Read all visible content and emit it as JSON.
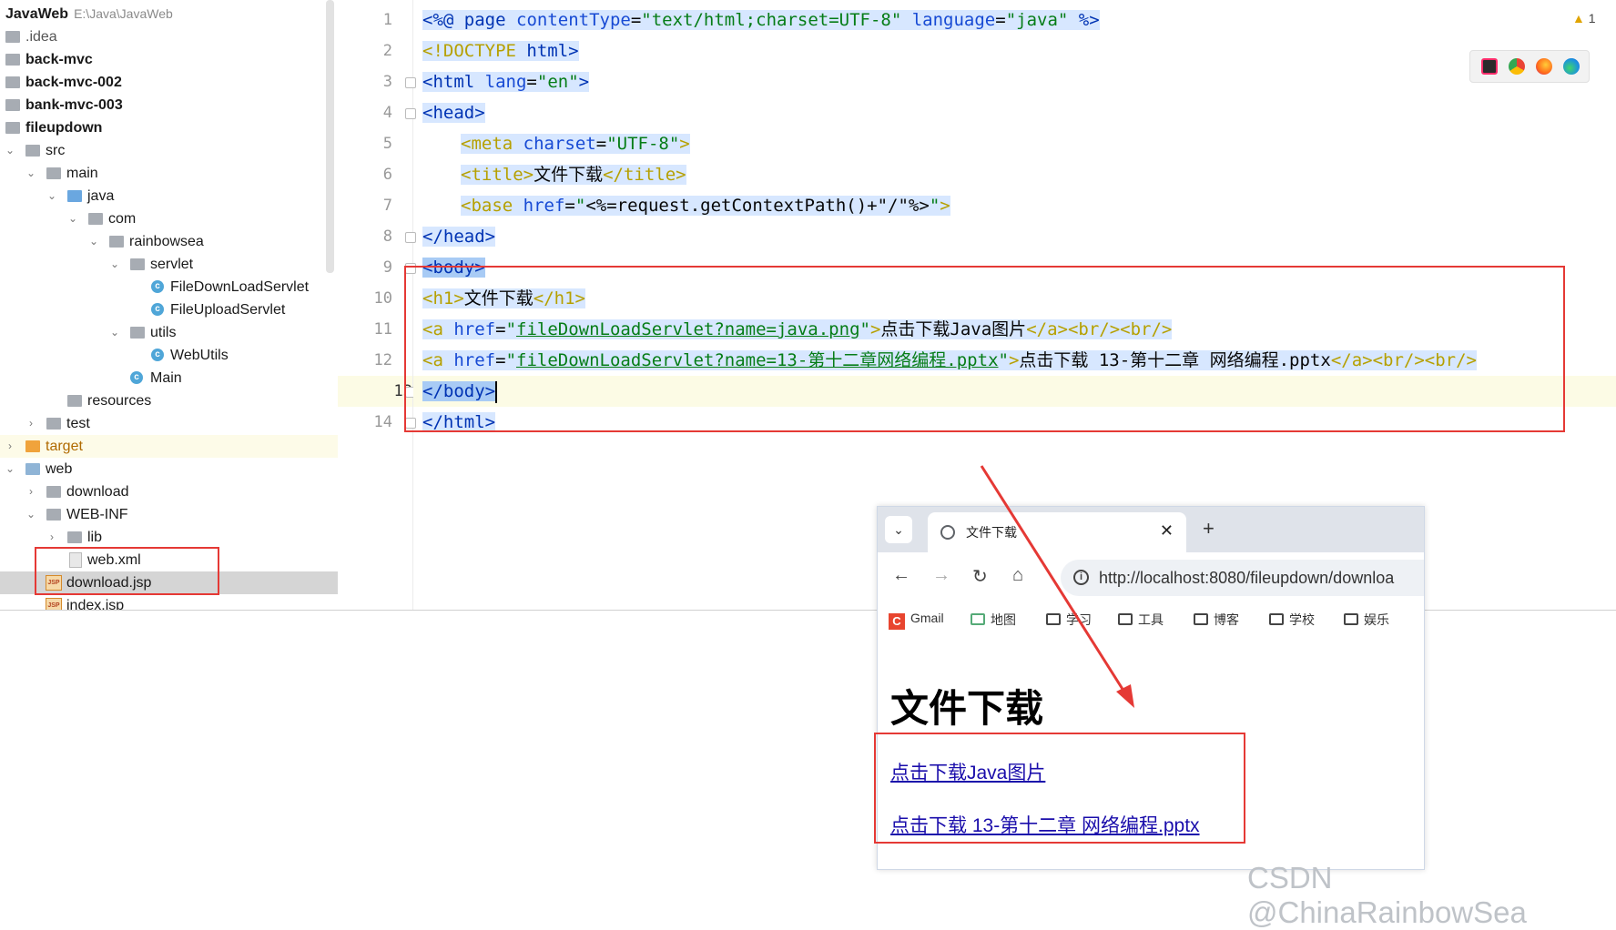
{
  "project_tree": {
    "root_name": "JavaWeb",
    "root_path": "E:\\Java\\JavaWeb",
    "items": [
      {
        "label": ".idea"
      },
      {
        "label": "back-mvc"
      },
      {
        "label": "back-mvc-002"
      },
      {
        "label": "bank-mvc-003"
      },
      {
        "label": "fileupdown"
      },
      {
        "label": "src"
      },
      {
        "label": "main"
      },
      {
        "label": "java"
      },
      {
        "label": "com"
      },
      {
        "label": "rainbowsea"
      },
      {
        "label": "servlet"
      },
      {
        "label": "FileDownLoadServlet"
      },
      {
        "label": "FileUploadServlet"
      },
      {
        "label": "utils"
      },
      {
        "label": "WebUtils"
      },
      {
        "label": "Main"
      },
      {
        "label": "resources"
      },
      {
        "label": "test"
      },
      {
        "label": "target"
      },
      {
        "label": "web"
      },
      {
        "label": "download"
      },
      {
        "label": "WEB-INF"
      },
      {
        "label": "lib"
      },
      {
        "label": "web.xml"
      },
      {
        "label": "download.jsp"
      },
      {
        "label": "index.jsp"
      }
    ]
  },
  "editor": {
    "line_numbers": [
      "1",
      "2",
      "3",
      "4",
      "5",
      "6",
      "7",
      "8",
      "9",
      "10",
      "11",
      "12",
      "13",
      "14"
    ],
    "l1": {
      "open": "<%@",
      "kw": "page",
      "a1": "contentType",
      "eq1": "=",
      "v1": "\"text/html;charset=UTF-8\"",
      "a2": "language",
      "eq2": "=",
      "v2": "\"java\"",
      "close": "%>"
    },
    "l2": {
      "doctype": "<!DOCTYPE",
      "html": "html",
      "gt": ">"
    },
    "l3": {
      "open": "<html",
      "attr": "lang",
      "eq": "=",
      "val": "\"en\"",
      "gt": ">"
    },
    "l4": {
      "text": "<head>"
    },
    "l5": {
      "open": "<meta",
      "attr": "charset",
      "eq": "=",
      "val": "\"UTF-8\"",
      "gt": ">"
    },
    "l6": {
      "open": "<title>",
      "text": "文件下载",
      "close": "</title>"
    },
    "l7": {
      "open": "<base",
      "attr": "href",
      "eq": "=",
      "q1": "\"",
      "expr": "<%=request.getContextPath()+\"/\"%>",
      "q2": "\"",
      "gt": ">"
    },
    "l8": {
      "text": "</head>"
    },
    "l9": {
      "text": "<body>"
    },
    "l10": {
      "open": "<h1>",
      "text": "文件下载",
      "close": "</h1>"
    },
    "l11": {
      "open": "<a",
      "attr": "href",
      "eq": "=",
      "q1": "\"",
      "url": "fileDownLoadServlet?name=java.png",
      "q2": "\"",
      "gt": ">",
      "text": "点击下载Java图片",
      "close": "</a><br/><br/>"
    },
    "l12": {
      "open": "<a",
      "attr": "href",
      "eq": "=",
      "q1": "\"",
      "url": "fileDownLoadServlet?name=13-第十二章网络编程.pptx",
      "q2": "\"",
      "gt": ">",
      "text": "点击下载 13-第十二章 网络编程.pptx",
      "close": "</a><br/><br/>"
    },
    "l13": {
      "text": "</body>"
    },
    "l14": {
      "text": "</html>"
    }
  },
  "inspection": {
    "warning_count": "1"
  },
  "browser": {
    "tab_title": "文件下载",
    "url": "http://localhost:8080/fileupdown/downloa",
    "bookmarks": [
      "Gmail",
      "地图",
      "学习",
      "工具",
      "博客",
      "学校",
      "娱乐"
    ],
    "page_heading": "文件下载",
    "link1": "点击下载Java图片",
    "link2": "点击下载 13-第十二章 网络编程.pptx"
  },
  "watermark": "CSDN @ChinaRainbowSea",
  "colors": {
    "highlight_box": "#e53935",
    "arrow": "#e53935",
    "link": "#1a0dab"
  }
}
